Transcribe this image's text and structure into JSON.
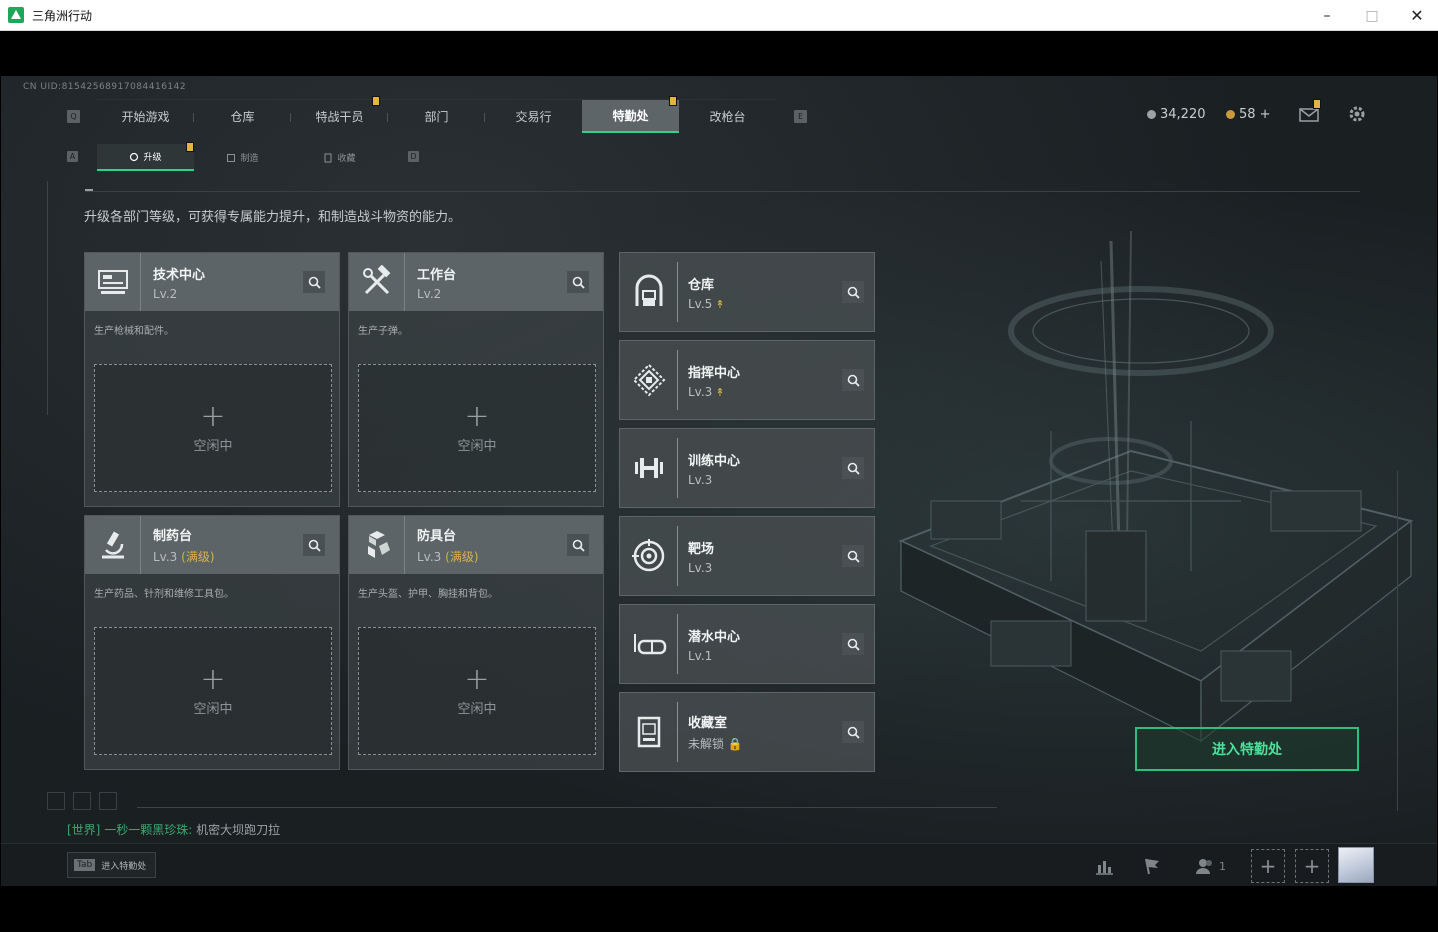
{
  "window": {
    "title": "三角洲行动"
  },
  "uid": "CN UID:8154256891708441614​2",
  "nav": {
    "left_key": "Q",
    "right_key": "E",
    "items": [
      {
        "label": "开始游戏",
        "active": false
      },
      {
        "label": "仓库",
        "active": false
      },
      {
        "label": "特战干员",
        "active": false,
        "badge": true
      },
      {
        "label": "部门",
        "active": false
      },
      {
        "label": "交易行",
        "active": false
      },
      {
        "label": "特勤处",
        "active": true,
        "badge": true
      },
      {
        "label": "改枪台",
        "active": false
      }
    ]
  },
  "subnav": {
    "left_key": "A",
    "right_key": "D",
    "items": [
      {
        "label": "升级",
        "active": true
      },
      {
        "label": "制造",
        "active": false
      },
      {
        "label": "收藏",
        "active": false
      }
    ]
  },
  "currency": {
    "coins": "34,220",
    "tickets": "58 +"
  },
  "description": "升级各部门等级，可获得专属能力提升，和制造战斗物资的能力。",
  "cards": [
    {
      "name": "技术中心",
      "level": "Lv.2",
      "max": "",
      "desc": "生产枪械和配件。",
      "slot_label": "空闲中"
    },
    {
      "name": "工作台",
      "level": "Lv.2",
      "max": "",
      "desc": "生产子弹。",
      "slot_label": "空闲中"
    },
    {
      "name": "制药台",
      "level": "Lv.3",
      "max": "(满级)",
      "desc": "生产药品、针剂和维修工具包。",
      "slot_label": "空闲中"
    },
    {
      "name": "防具台",
      "level": "Lv.3",
      "max": "(满级)",
      "desc": "生产头盔、护甲、胸挂和背包。",
      "slot_label": "空闲中"
    }
  ],
  "small_cards": [
    {
      "name": "仓库",
      "level": "Lv.5",
      "upgradable": true
    },
    {
      "name": "指挥中心",
      "level": "Lv.3",
      "upgradable": true
    },
    {
      "name": "训练中心",
      "level": "Lv.3",
      "upgradable": false
    },
    {
      "name": "靶场",
      "level": "Lv.3",
      "upgradable": false
    },
    {
      "name": "潜水中心",
      "level": "Lv.1",
      "upgradable": false
    },
    {
      "name": "收藏室",
      "level": "未解锁",
      "upgradable": false,
      "locked": true
    }
  ],
  "enter_button": "进入特勤处",
  "chat": {
    "channel": "[世界]",
    "sender": "一秒一颗黑珍珠:",
    "message": "机密大坝跑刀拉"
  },
  "tab_hint": {
    "key": "Tab",
    "label": "进入特勤处"
  },
  "bottom": {
    "friends_count": "1"
  },
  "colors": {
    "accent": "#2fd28a",
    "badge": "#e2b53c",
    "max_level": "#d8b24a"
  }
}
